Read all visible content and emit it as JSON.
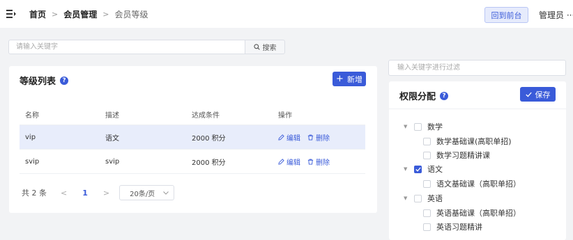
{
  "header": {
    "breadcrumb": [
      "首页",
      "会员管理",
      "会员等级"
    ],
    "back_button": "回到前台",
    "user": "管理员 ···"
  },
  "search": {
    "placeholder": "请输入关键字",
    "button": "搜索"
  },
  "level_list": {
    "title": "等级列表",
    "add_button": "新增",
    "columns": [
      "名称",
      "描述",
      "达成条件",
      "操作"
    ],
    "rows": [
      {
        "name": "vip",
        "desc": "语文",
        "condition": "2000 积分",
        "edit": "编辑",
        "delete": "删除"
      },
      {
        "name": "svip",
        "desc": "svip",
        "condition": "2000 积分",
        "edit": "编辑",
        "delete": "删除"
      }
    ],
    "pagination": {
      "total": "共 2 条",
      "page": "1",
      "page_size": "20条/页"
    }
  },
  "permissions": {
    "filter_placeholder": "输入关键字进行过滤",
    "title": "权限分配",
    "save_button": "保存",
    "tree": [
      {
        "label": "数学",
        "checked": false,
        "children": [
          {
            "label": "数学基础课(高职单招)",
            "checked": false
          },
          {
            "label": "数学习题精讲课",
            "checked": false
          }
        ]
      },
      {
        "label": "语文",
        "checked": true,
        "children": [
          {
            "label": "语文基础课（高职单招）",
            "checked": false
          }
        ]
      },
      {
        "label": "英语",
        "checked": false,
        "children": [
          {
            "label": "英语基础课（高职单招）",
            "checked": false
          },
          {
            "label": "英语习题精讲",
            "checked": false
          }
        ]
      }
    ]
  },
  "colors": {
    "primary": "#3a5bd9",
    "row_highlight": "#e8edfb"
  }
}
